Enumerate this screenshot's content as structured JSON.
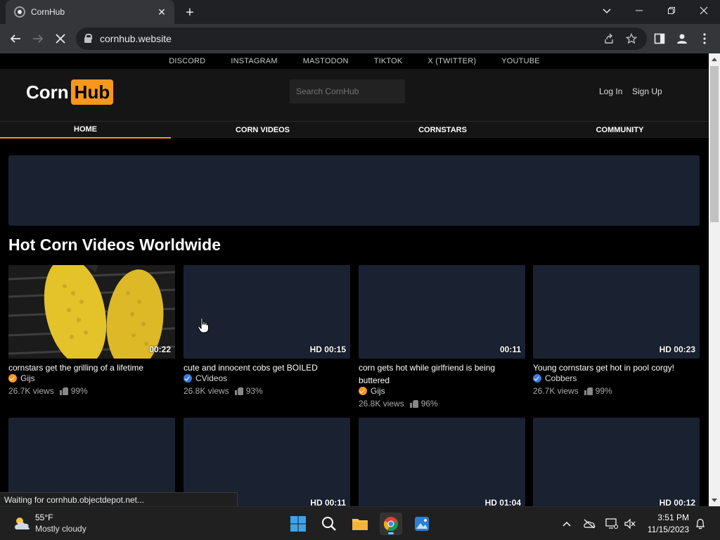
{
  "browser": {
    "tab_title": "CornHub",
    "url": "cornhub.website",
    "status": "Waiting for cornhub.objectdepot.net..."
  },
  "site": {
    "social_links": [
      "DISCORD",
      "INSTAGRAM",
      "MASTODON",
      "TIKTOK",
      "X (TWITTER)",
      "YOUTUBE"
    ],
    "logo_part1": "Corn",
    "logo_part2": "Hub",
    "search_placeholder": "Search CornHub",
    "login": "Log In",
    "signup": "Sign Up",
    "nav": [
      "HOME",
      "CORN VIDEOS",
      "CORNSTARS",
      "COMMUNITY"
    ],
    "active_nav": "HOME",
    "section_title": "Hot Corn Videos Worldwide",
    "accent_color": "#f7971e",
    "placeholder_color": "#1a2232"
  },
  "videos": [
    {
      "title": "cornstars get the grilling of a lifetime",
      "duration": "00:22",
      "uploader": "Gijs",
      "badge": "orange",
      "views": "26.7K views",
      "rating": "99%",
      "thumbnail": "grilled-corn"
    },
    {
      "title": "cute and innocent cobs get BOILED",
      "duration": "HD 00:15",
      "uploader": "CVideos",
      "badge": "blue",
      "views": "26.8K views",
      "rating": "93%",
      "thumbnail": "none"
    },
    {
      "title": "corn gets hot while girlfriend is being buttered",
      "duration": "00:11",
      "uploader": "Gijs",
      "badge": "orange",
      "views": "26.8K views",
      "rating": "96%",
      "thumbnail": "none"
    },
    {
      "title": "Young cornstars get hot in pool corgy!",
      "duration": "HD 00:23",
      "uploader": "Cobbers",
      "badge": "blue",
      "views": "26.7K views",
      "rating": "99%",
      "thumbnail": "none"
    }
  ],
  "videos_row2": [
    {
      "duration": ""
    },
    {
      "duration": "HD 00:11"
    },
    {
      "duration": "HD 01:04"
    },
    {
      "duration": "HD 00:12"
    }
  ],
  "taskbar": {
    "temp": "55°F",
    "weather": "Mostly cloudy",
    "time": "3:51 PM",
    "date": "11/15/2023"
  }
}
